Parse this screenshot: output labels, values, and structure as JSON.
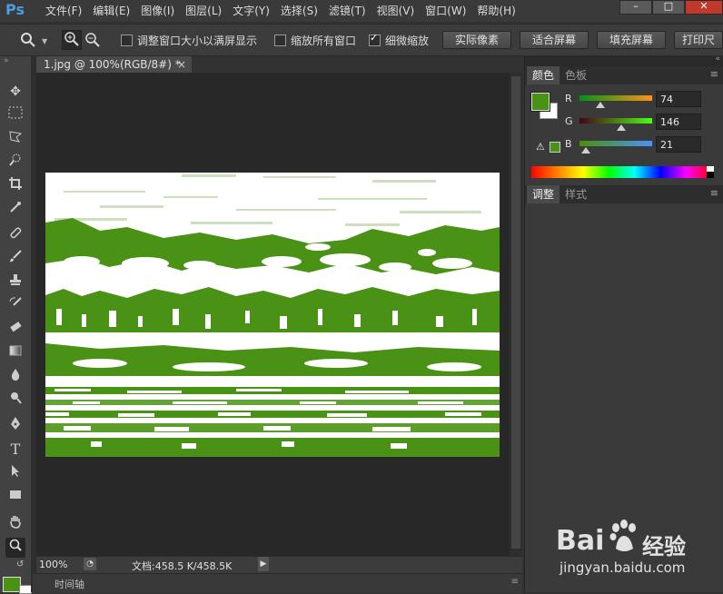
{
  "app": {
    "logo": "Ps"
  },
  "menu": [
    "文件(F)",
    "编辑(E)",
    "图像(I)",
    "图层(L)",
    "文字(Y)",
    "选择(S)",
    "滤镜(T)",
    "视图(V)",
    "窗口(W)",
    "帮助(H)"
  ],
  "window_controls": {
    "minimize": "–",
    "maximize": "□",
    "close": "✕"
  },
  "options": {
    "resize_windows": "调整窗口大小以满屏显示",
    "zoom_all_windows": "缩放所有窗口",
    "scrubby_zoom": "细微缩放",
    "btn_actual_pixels": "实际像素",
    "btn_fit_screen": "适合屏幕",
    "btn_fill_screen": "填充屏幕",
    "btn_print_size": "打印尺"
  },
  "document": {
    "tab_title": "1.jpg @ 100%(RGB/8#) *",
    "zoom": "100%",
    "doc_size": "文档:458.5 K/458.5K",
    "timeline_label": "时间轴"
  },
  "color_panel": {
    "tabs": [
      "颜色",
      "色板"
    ],
    "r_label": "R",
    "r_value": "74",
    "g_label": "G",
    "g_value": "146",
    "b_label": "B",
    "b_value": "21",
    "foreground_color": "#4a9215"
  },
  "adjust_panel": {
    "tabs": [
      "调整",
      "样式"
    ]
  },
  "watermark": {
    "brand": "Bai",
    "brand_cn": "经验",
    "url": "jingyan.baidu.com"
  },
  "colors": {
    "accent_green": "#4a9215",
    "ps_blue": "#4a9fe0"
  }
}
